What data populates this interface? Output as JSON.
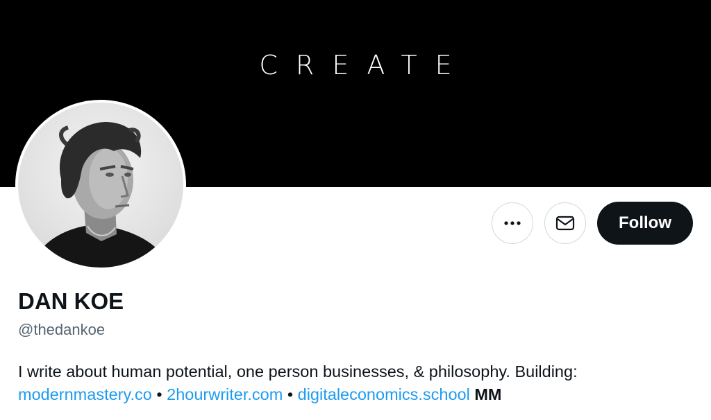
{
  "banner": {
    "text": "CREATE"
  },
  "profile": {
    "display_name": "DAN KOE",
    "handle": "@thedankoe",
    "bio_text": "I write about human potential, one person businesses, & philosophy. Building:",
    "links": [
      "modernmastery.co",
      "2hourwriter.com",
      "digitaleconomics.school"
    ],
    "separator": "•",
    "suffix": "MM"
  },
  "actions": {
    "more_icon": "more-horizontal-icon",
    "message_icon": "envelope-icon",
    "follow_label": "Follow"
  },
  "colors": {
    "link": "#1d9bf0",
    "text": "#0f1419",
    "secondary": "#536471",
    "banner": "#000000",
    "button_dark": "#0f1419"
  }
}
